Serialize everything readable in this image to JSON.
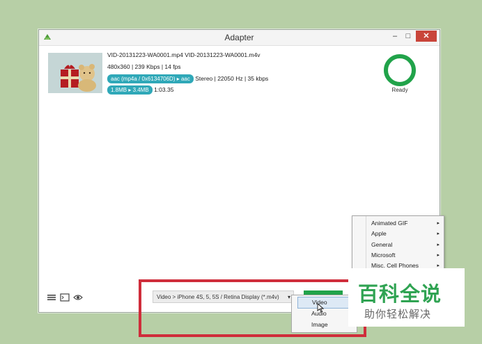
{
  "window": {
    "title": "Adapter",
    "minimize_label": "–",
    "maximize_label": "□",
    "close_label": "✕"
  },
  "file": {
    "names": "VID-20131223-WA0001.mp4   VID-20131223-WA0001.m4v",
    "video_info": "480x360  |  239 Kbps  |  14 fps",
    "audio_codec": "aac (mp4a / 0x6134706D) ▸ aac",
    "audio_info": "Stereo  |  22050 Hz  |  35 kbps",
    "size": "1.8MB ▸ 3.4MB",
    "duration": "1:03.35"
  },
  "status": {
    "label": "Ready",
    "color": "#21a34a"
  },
  "preset": {
    "selected": "Video > iPhone 4S, 5, 5S / Retina Display (*.m4v)",
    "arrow": "▾"
  },
  "menu": {
    "items": [
      {
        "label": "Animated GIF"
      },
      {
        "label": "Apple"
      },
      {
        "label": "General"
      },
      {
        "label": "Microsoft"
      },
      {
        "label": "Misc. Cell Phones"
      }
    ],
    "arrow": "▸"
  },
  "submenu": {
    "items": [
      {
        "label": "Video"
      },
      {
        "label": "Audio"
      },
      {
        "label": "Image"
      }
    ]
  },
  "watermark": {
    "main": "百科全说",
    "sub": "助你轻松解决"
  },
  "icons": [
    "app-icon",
    "list-icon",
    "terminal-icon",
    "eye-icon",
    "cursor-icon"
  ]
}
